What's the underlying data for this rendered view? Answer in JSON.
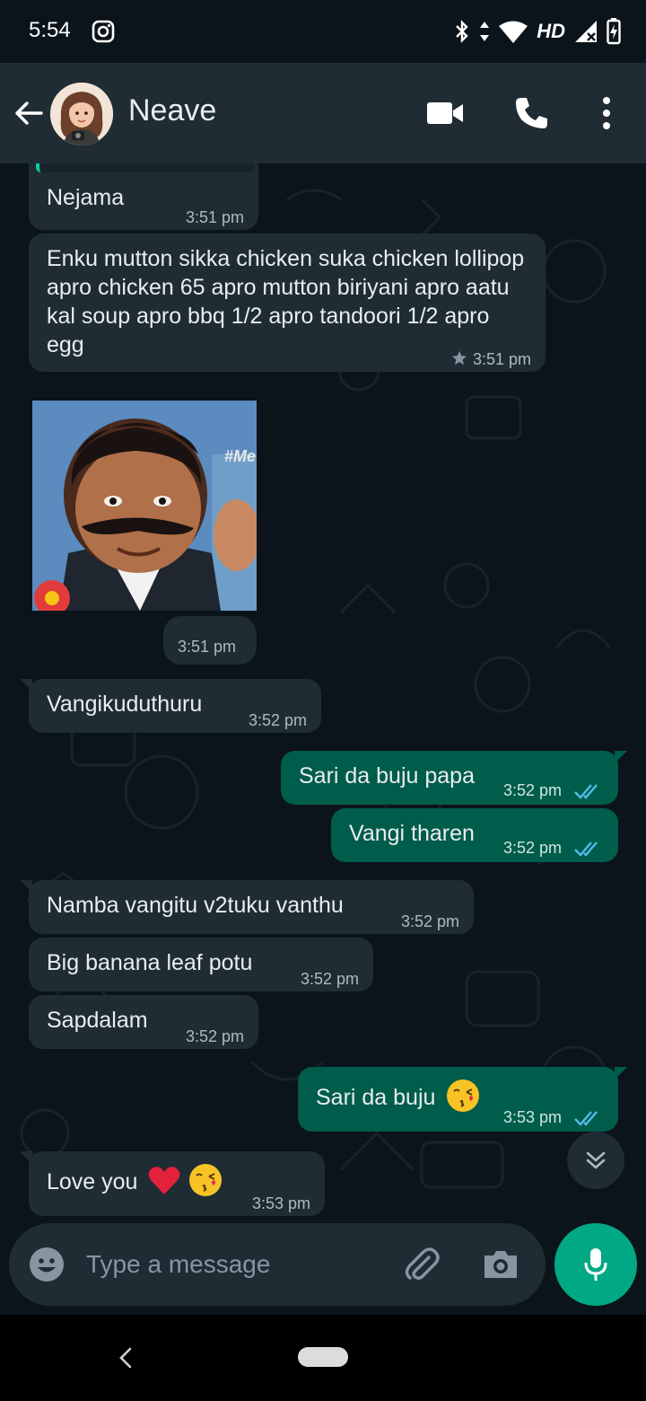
{
  "status_bar": {
    "time": "5:54",
    "network": "HD"
  },
  "header": {
    "contact_name": "Neave"
  },
  "messages": [
    {
      "dir": "in",
      "text": "Nejama",
      "time": "3:51 pm"
    },
    {
      "dir": "in",
      "text": "Enku mutton sikka chicken suka chicken lollipop apro chicken 65 apro mutton biriyani apro aatu kal soup apro bbq 1/2 apro tandoori 1/2 apro egg",
      "time": "3:51 pm",
      "starred": true
    },
    {
      "dir": "in",
      "type": "image",
      "overlay_text": "#Me",
      "time": "3:51 pm"
    },
    {
      "dir": "in",
      "text": "Vangikuduthuru",
      "time": "3:52 pm"
    },
    {
      "dir": "out",
      "text": "Sari da buju papa",
      "time": "3:52 pm",
      "status": "read"
    },
    {
      "dir": "out",
      "text": "Vangi tharen",
      "time": "3:52 pm",
      "status": "read"
    },
    {
      "dir": "in",
      "text": "Namba vangitu v2tuku vanthu",
      "time": "3:52 pm"
    },
    {
      "dir": "in",
      "text": "Big banana leaf potu",
      "time": "3:52 pm"
    },
    {
      "dir": "in",
      "text": "Sapdalam",
      "time": "3:52 pm"
    },
    {
      "dir": "out",
      "text": "Sari da buju",
      "emoji": "kissing-face",
      "time": "3:53 pm",
      "status": "read"
    },
    {
      "dir": "in",
      "text": "Love you",
      "emoji": "red-heart kissing-face",
      "time": "3:53 pm"
    }
  ],
  "composer": {
    "placeholder": "Type a message"
  },
  "colors": {
    "incoming": "#1f2c34",
    "outgoing": "#005c4b",
    "accent": "#00a884",
    "read_tick": "#53bdeb",
    "background": "#0b141a"
  }
}
